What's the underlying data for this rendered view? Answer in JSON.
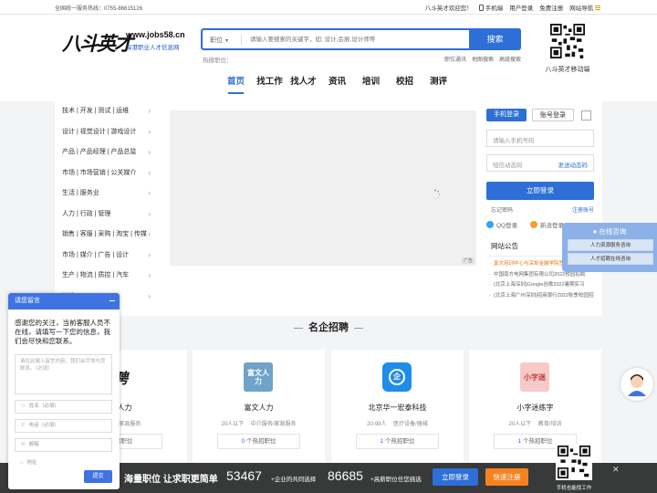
{
  "topbar": {
    "hotline": "全国统一服务热线：0755-86615126",
    "welcome": "八斗英才欢迎您！",
    "mobile": "手机端",
    "user_login": "用户登录",
    "register": "免费注册",
    "site_nav": "网站导航"
  },
  "logo": {
    "cn": "八斗英才",
    "url": "www.jobs58.cn",
    "sub": "深港职业人才信息网"
  },
  "search": {
    "type": "职位",
    "placeholder": "请输入要搜索的关键字，如: 设计,会展,设计师等",
    "button": "搜索",
    "hot": "热搜职位：",
    "links": [
      "职位通讯",
      "地图搜索",
      "高级搜索"
    ]
  },
  "qr_top_label": "八斗英才移动端",
  "nav": [
    "首页",
    "找工作",
    "找人才",
    "资讯",
    "培训",
    "校招",
    "测评"
  ],
  "categories": [
    "技术 | 开发 | 测试 | 运维",
    "设计 | 视觉设计 | 游戏设计",
    "产品 | 产品经理 | 产品总监",
    "市场 | 市场营销 | 公关媒介",
    "生活 | 服务业",
    "人力 | 行政 | 管理",
    "销售 | 客服 | 采购 | 淘宝 | 传媒",
    "市场 | 媒介 | 广告 | 设计",
    "生产 | 物流 | 质控 | 汽车",
    "其他"
  ],
  "banner": {
    "ad": "广告"
  },
  "login": {
    "tab_phone": "手机登录",
    "tab_account": "账号登录",
    "phone_placeholder": "请输入手机号码",
    "code_placeholder": "短信动态码",
    "send_code": "发送动态码",
    "submit": "立即登录",
    "forgot": "忘记密码",
    "register": "注册账号",
    "qq": "QQ登录",
    "weibo": "新浪登录"
  },
  "notice": {
    "title": "网站公告",
    "items": [
      "富文培训中心与深圳金融学院签约合作",
      "中国南方电网集团有限公司2022校园招聘",
      "(北京上海深圳)Google谷歌2022暑期实习",
      "(北京上海广州深圳)招商银行2022秋季校园招聘"
    ]
  },
  "consult": {
    "title": "在线咨询",
    "items": [
      "人力资源服务咨询",
      "人才招聘在线咨询"
    ]
  },
  "section_title": "名企招聘",
  "companies": [
    {
      "name": "文人力",
      "meta": "介服务/家政服务",
      "jobs_count": "",
      "jobs_label": "热招职位",
      "logo": "聘"
    },
    {
      "name": "富文人力",
      "meta": "20人以下 　中介服务/家政服务",
      "jobs_count": "0",
      "jobs_label": "个热招职位",
      "logo": "富文人力"
    },
    {
      "name": "北京华一宏泰科技",
      "meta": "20-99人 　医疗设备/器械",
      "jobs_count": "1",
      "jobs_label": "个热招职位",
      "logo": "企"
    },
    {
      "name": "小字迷练字",
      "meta": "20人以下 　教育/培训",
      "jobs_count": "1",
      "jobs_label": "个热招职位",
      "logo": "小字迷"
    }
  ],
  "message": {
    "title": "请您留言",
    "intro": "感谢您的关注，当前客服人员不在线，请填写一下您的信息，我们会尽快和您联系。",
    "textarea_placeholder": "请在此输入留言内容，我们会尽快与您联系。（必填）",
    "fields": [
      {
        "icon": "person",
        "label": "姓名（必填）"
      },
      {
        "icon": "phone",
        "label": "电话（必填）"
      },
      {
        "icon": "mail",
        "label": "邮箱"
      },
      {
        "icon": "location",
        "label": "地址"
      }
    ],
    "submit": "提交"
  },
  "bottom": {
    "slogan": "海量职位 让求职更简单",
    "count1": "53467",
    "text1": "+企业的共同选择",
    "count2": "86685",
    "text2": "+高薪职位任您挑选",
    "login": "立即登录",
    "register": "快速注册",
    "qr_label": "手机也能找工作"
  },
  "colors": {
    "accent": "#2d6fd6",
    "orange": "#f5821f"
  }
}
